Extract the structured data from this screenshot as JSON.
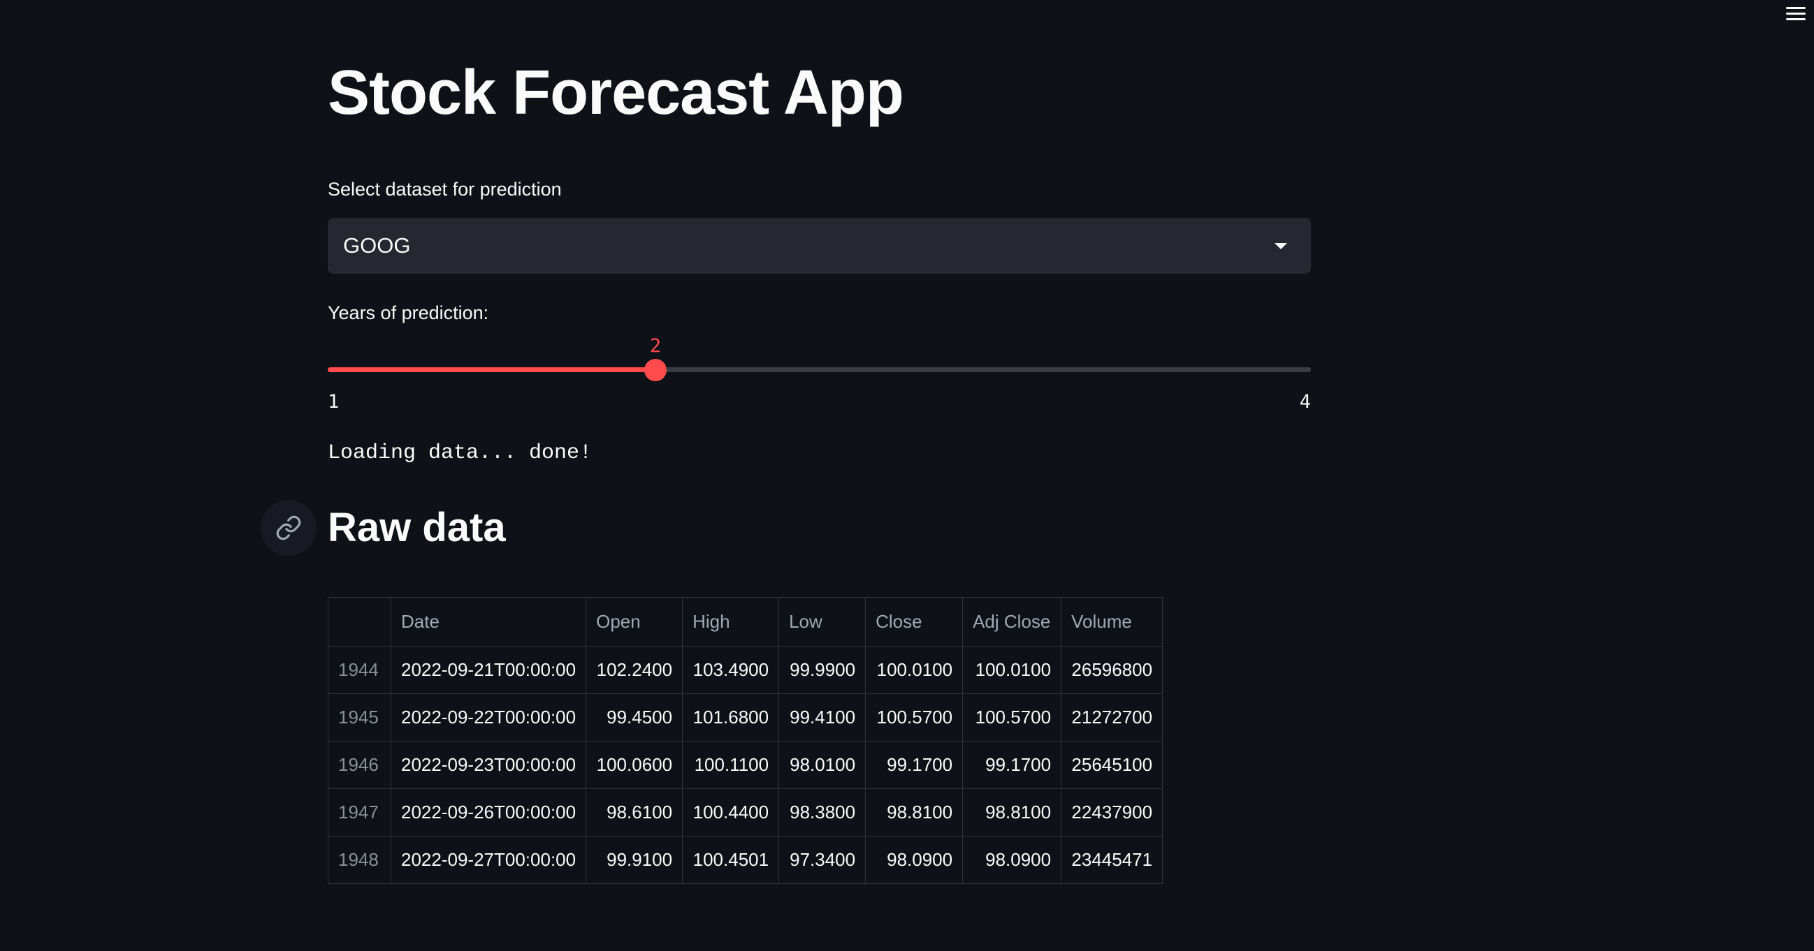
{
  "app": {
    "title": "Stock Forecast App"
  },
  "dataset_select": {
    "label": "Select dataset for prediction",
    "value": "GOOG"
  },
  "years_slider": {
    "label": "Years of prediction:",
    "value": 2,
    "value_text": "2",
    "min": 1,
    "max": 4,
    "min_text": "1",
    "max_text": "4",
    "accent_color": "#ff4b4b"
  },
  "status": {
    "text": "Loading data... done!"
  },
  "raw_data": {
    "heading": "Raw data",
    "columns": [
      "",
      "Date",
      "Open",
      "High",
      "Low",
      "Close",
      "Adj Close",
      "Volume"
    ],
    "rows": [
      [
        "1944",
        "2022-09-21T00:00:00",
        "102.2400",
        "103.4900",
        "99.9900",
        "100.0100",
        "100.0100",
        "26596800"
      ],
      [
        "1945",
        "2022-09-22T00:00:00",
        "99.4500",
        "101.6800",
        "99.4100",
        "100.5700",
        "100.5700",
        "21272700"
      ],
      [
        "1946",
        "2022-09-23T00:00:00",
        "100.0600",
        "100.1100",
        "98.0100",
        "99.1700",
        "99.1700",
        "25645100"
      ],
      [
        "1947",
        "2022-09-26T00:00:00",
        "98.6100",
        "100.4400",
        "98.3800",
        "98.8100",
        "98.8100",
        "22437900"
      ],
      [
        "1948",
        "2022-09-27T00:00:00",
        "99.9100",
        "100.4501",
        "97.3400",
        "98.0900",
        "98.0900",
        "23445471"
      ]
    ]
  },
  "icons": {
    "menu": "hamburger-menu-icon",
    "anchor": "link-icon",
    "dropdown": "chevron-down-icon"
  }
}
